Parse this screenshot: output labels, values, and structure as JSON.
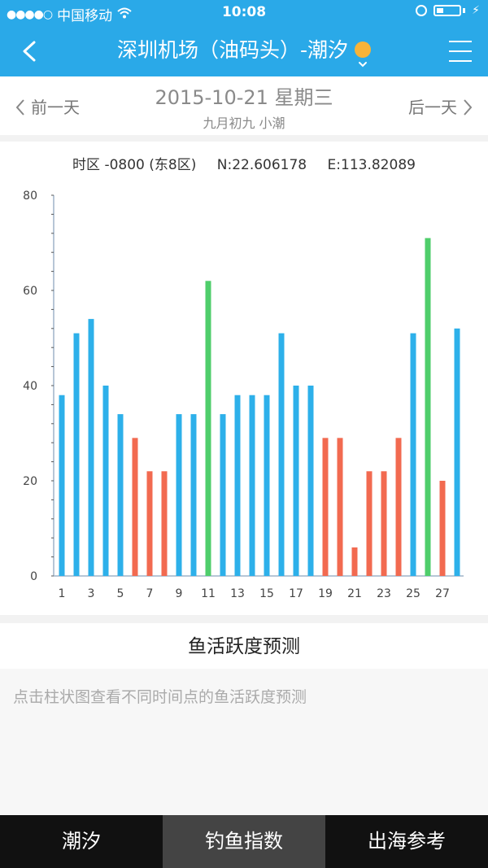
{
  "status": {
    "carrier": "中国移动",
    "time": "10:08"
  },
  "nav": {
    "title": "深圳机场（油码头）-潮汐"
  },
  "date": {
    "prev_label": "前一天",
    "next_label": "后一天",
    "main": "2015-10-21 星期三",
    "sub": "九月初九 小潮"
  },
  "info": {
    "timezone": "时区 -0800 (东8区)",
    "lat": "N:22.606178",
    "lon": "E:113.82089"
  },
  "chart_data": {
    "type": "bar",
    "categories": [
      1,
      2,
      3,
      4,
      5,
      6,
      7,
      8,
      9,
      10,
      11,
      12,
      13,
      14,
      15,
      16,
      17,
      18,
      19,
      20,
      21,
      22,
      23,
      24,
      25,
      26,
      27,
      28
    ],
    "x_tick_labels": [
      "1",
      "3",
      "5",
      "7",
      "9",
      "11",
      "13",
      "15",
      "17",
      "19",
      "21",
      "23",
      "25",
      "27"
    ],
    "values": [
      38,
      51,
      54,
      40,
      34,
      29,
      22,
      22,
      34,
      34,
      62,
      34,
      38,
      38,
      38,
      51,
      40,
      40,
      29,
      29,
      6,
      22,
      22,
      29,
      51,
      71,
      20,
      52
    ],
    "bar_colors": [
      "blue",
      "blue",
      "blue",
      "blue",
      "blue",
      "red",
      "red",
      "red",
      "blue",
      "blue",
      "green",
      "blue",
      "blue",
      "blue",
      "blue",
      "blue",
      "blue",
      "blue",
      "red",
      "red",
      "red",
      "red",
      "red",
      "red",
      "blue",
      "green",
      "red",
      "blue"
    ],
    "colors": {
      "blue": "#2db0ea",
      "red": "#f26a50",
      "green": "#4fce6b"
    },
    "ylim": [
      0,
      80
    ],
    "yticks": [
      0,
      20,
      40,
      60,
      80
    ],
    "grid": false
  },
  "section": {
    "title": "鱼活跃度预测",
    "hint": "点击柱状图查看不同时间点的鱼活跃度预测"
  },
  "tabs": [
    {
      "label": "潮汐",
      "active": false
    },
    {
      "label": "钓鱼指数",
      "active": true
    },
    {
      "label": "出海参考",
      "active": false
    }
  ]
}
